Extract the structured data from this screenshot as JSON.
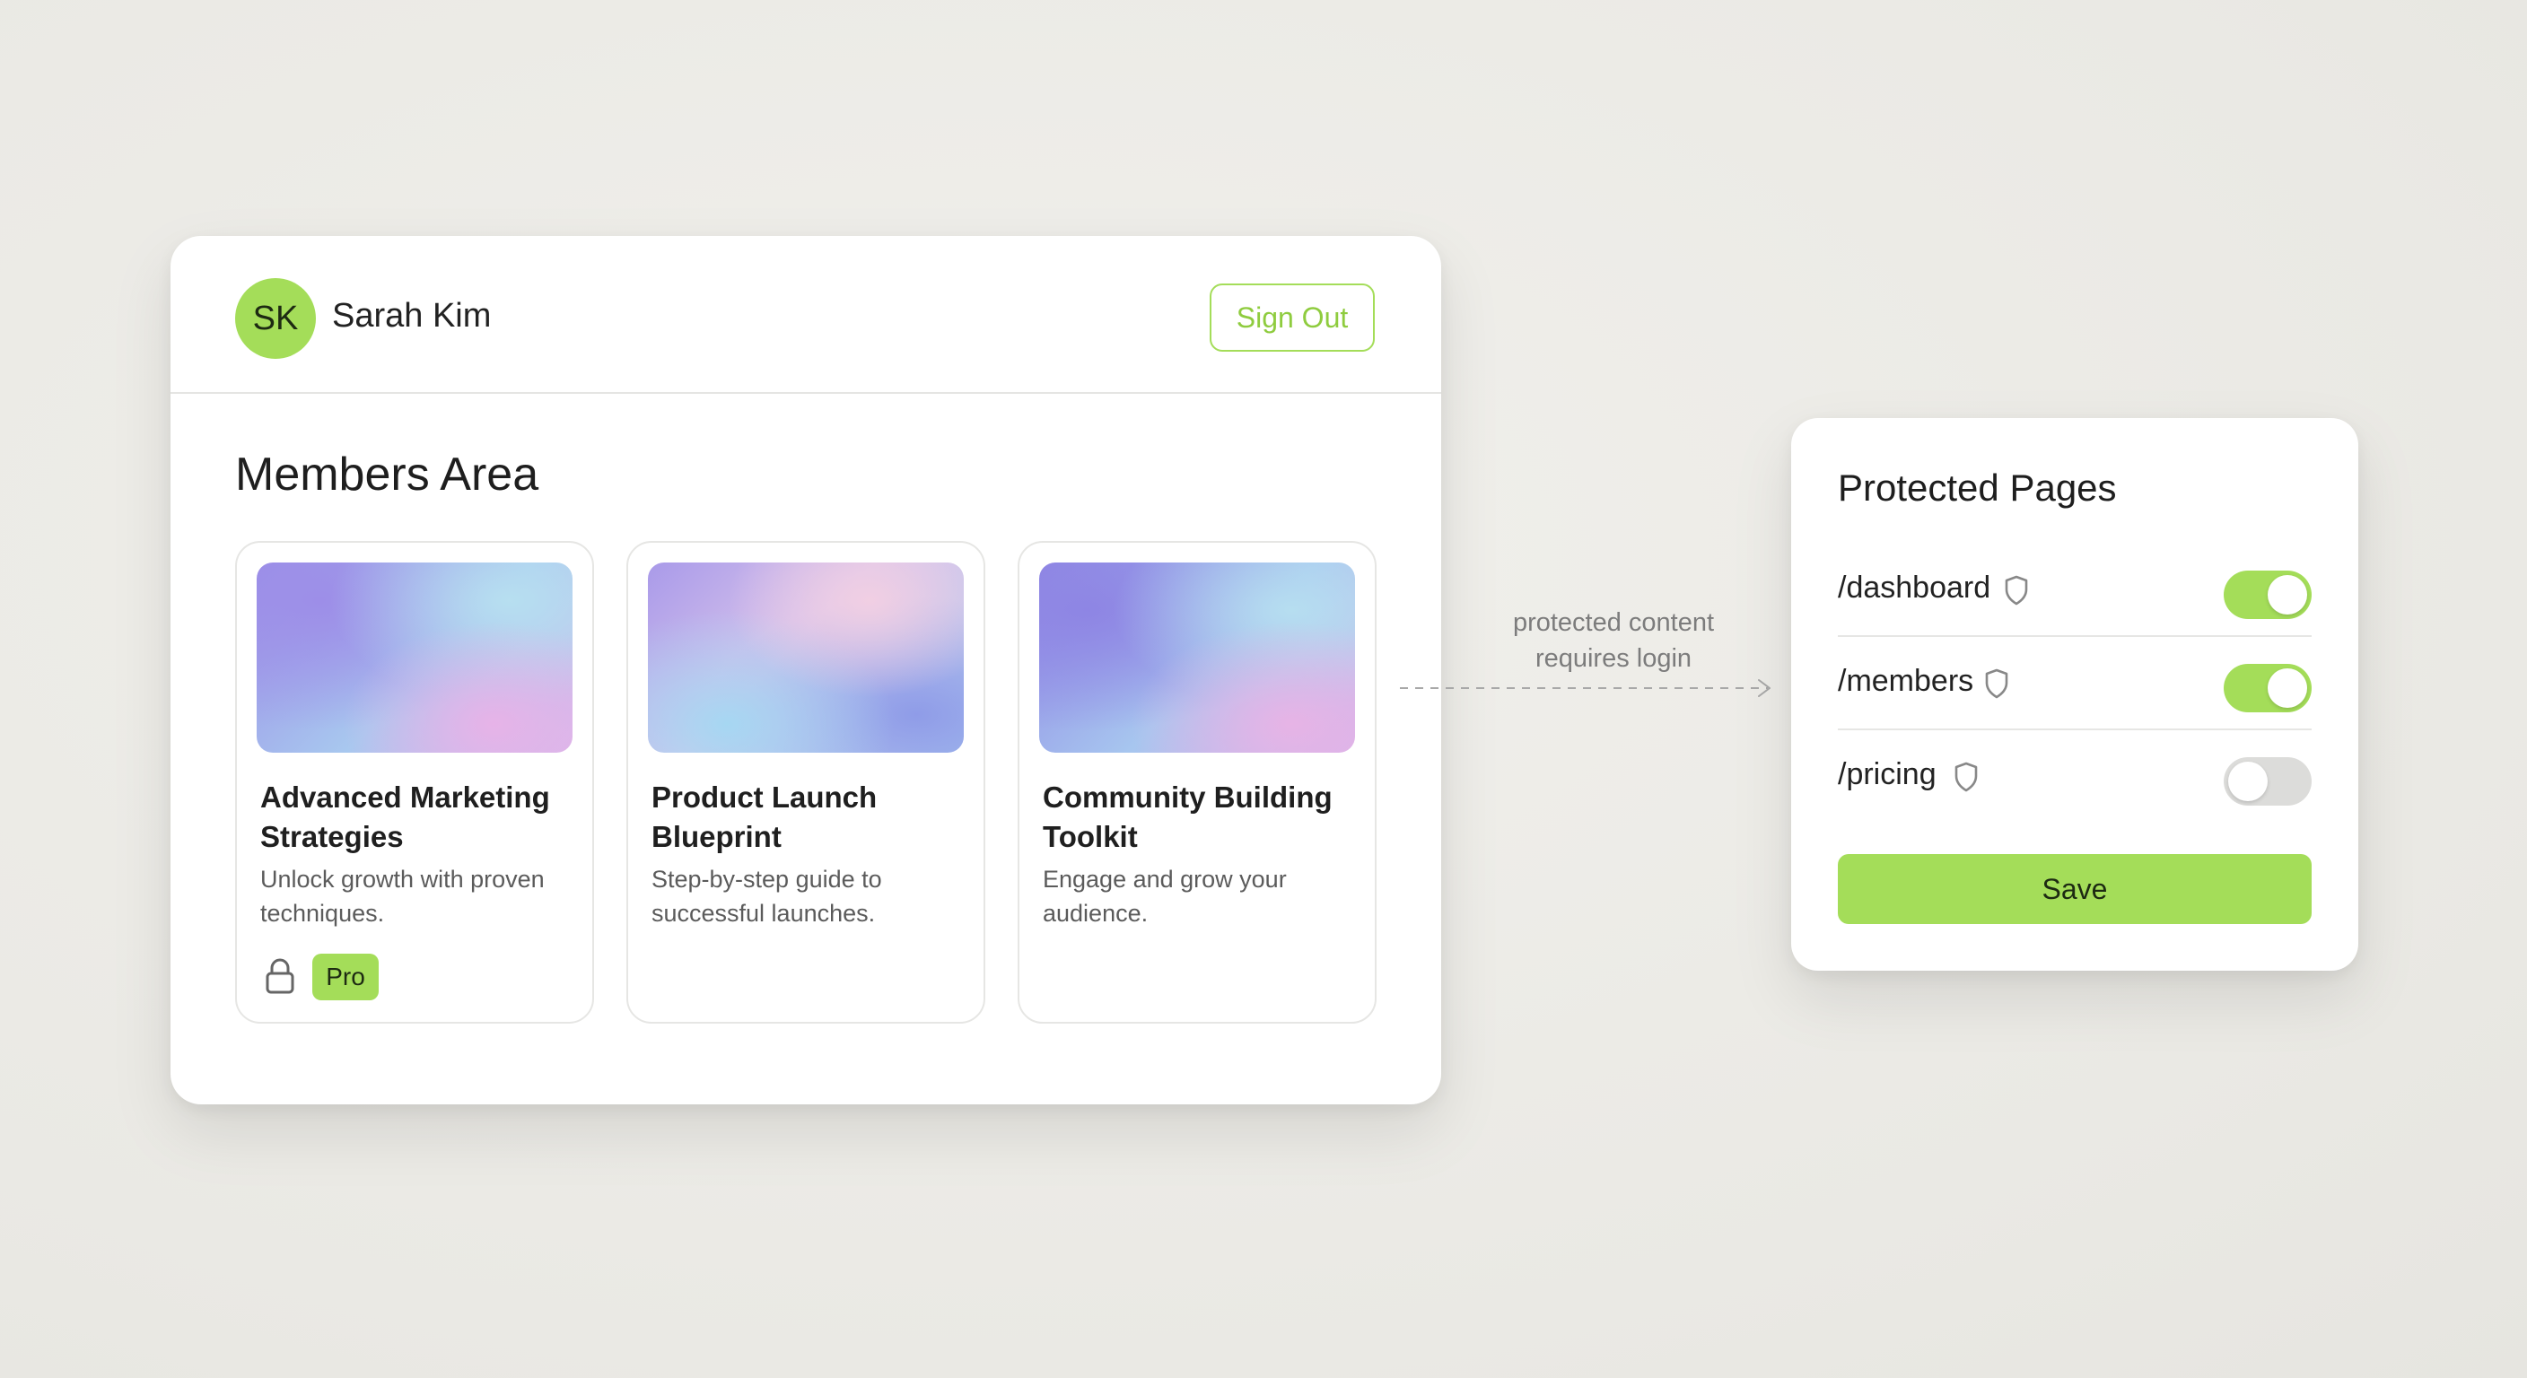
{
  "members_window": {
    "user": {
      "initials": "SK",
      "name": "Sarah Kim"
    },
    "sign_out_label": "Sign Out",
    "title": "Members Area",
    "cards": [
      {
        "title": "Advanced Marketing Strategies",
        "description": "Unlock growth with proven techniques.",
        "locked": true,
        "badge": "Pro"
      },
      {
        "title": "Product Launch Blueprint",
        "description": "Step-by-step guide to successful launches."
      },
      {
        "title": "Community Building Toolkit",
        "description": "Engage and grow your audience."
      }
    ]
  },
  "connector": {
    "line1": "protected content",
    "line2": "requires login"
  },
  "protected_pages": {
    "title": "Protected Pages",
    "routes": [
      {
        "path": "/dashboard",
        "enabled": true
      },
      {
        "path": "/members",
        "enabled": true
      },
      {
        "path": "/pricing",
        "enabled": false
      }
    ],
    "save_label": "Save"
  },
  "colors": {
    "accent": "#a4dd59",
    "accent_text": "#8fcc3f",
    "background": "#ecebe7",
    "toggle_off": "#dcdcda"
  },
  "icons": {
    "lock": "lock-icon",
    "shield": "shield-icon",
    "arrow": "arrow-right-icon"
  }
}
